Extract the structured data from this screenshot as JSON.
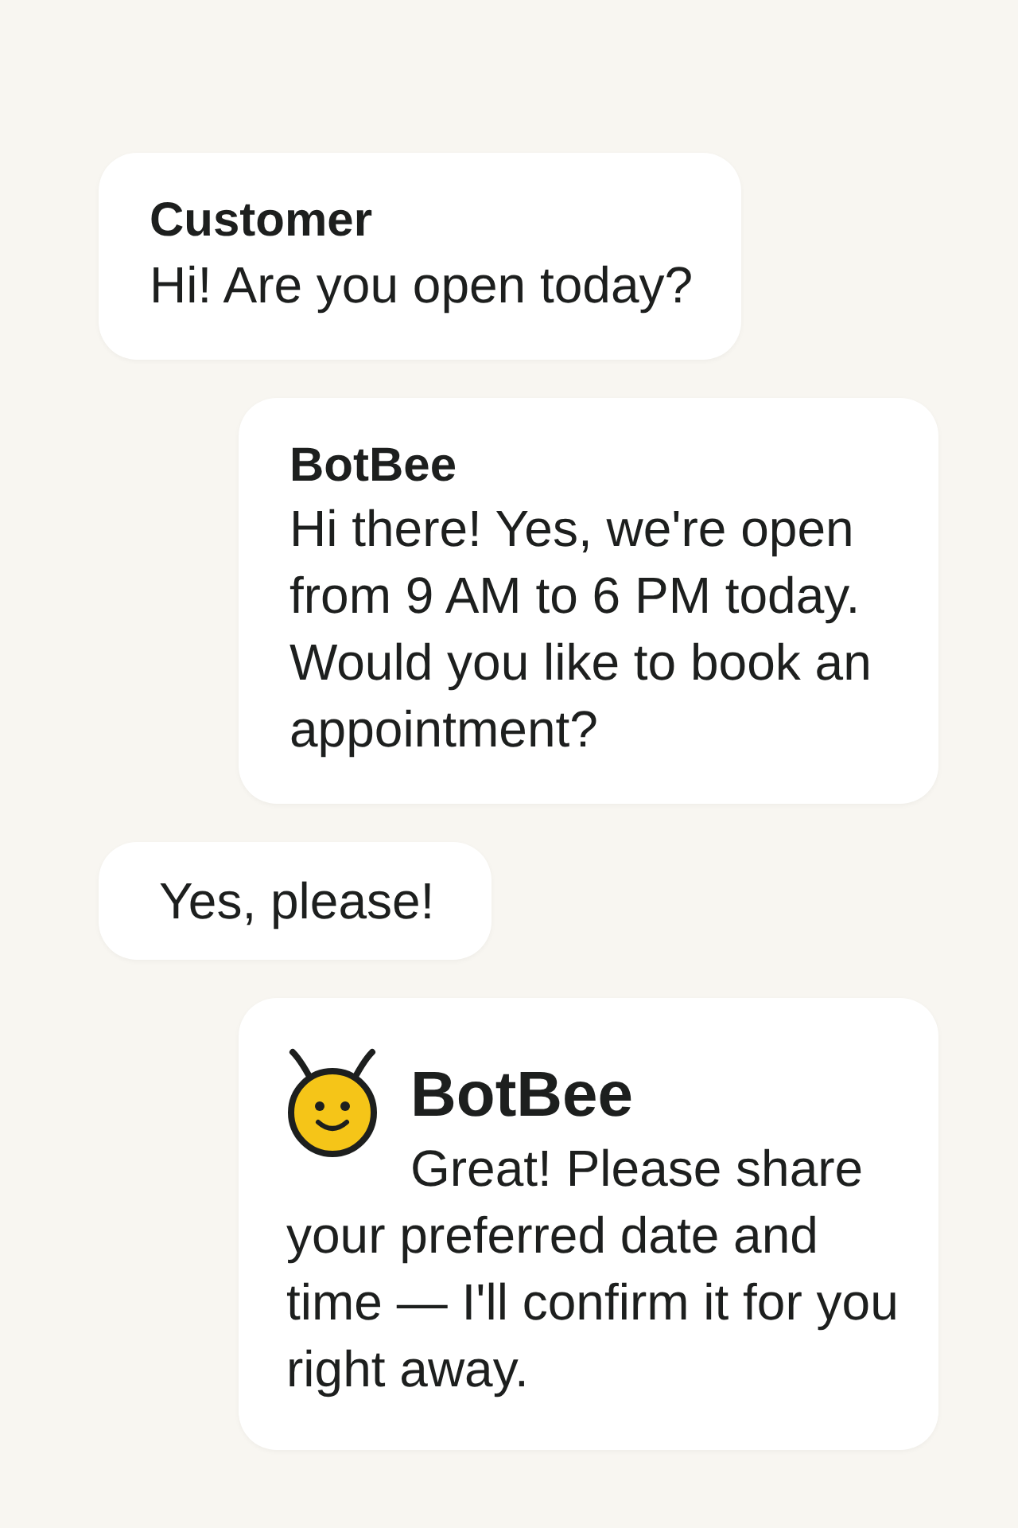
{
  "messages": [
    {
      "kind": "customer",
      "sender": "Customer",
      "text": "Hi! Are you open today?",
      "avatar": false
    },
    {
      "kind": "bot",
      "sender": "BotBee",
      "text": "Hi there! Yes, we're open from 9 AM to 6 PM today. Would you like to book an appointment?",
      "avatar": false
    },
    {
      "kind": "customer",
      "text": "Yes, please!",
      "avatar": false
    },
    {
      "kind": "bot",
      "sender": "BotBee",
      "text": "Great! Please share your preferred date and time — I'll confirm it for you right away.",
      "avatar": true
    }
  ]
}
